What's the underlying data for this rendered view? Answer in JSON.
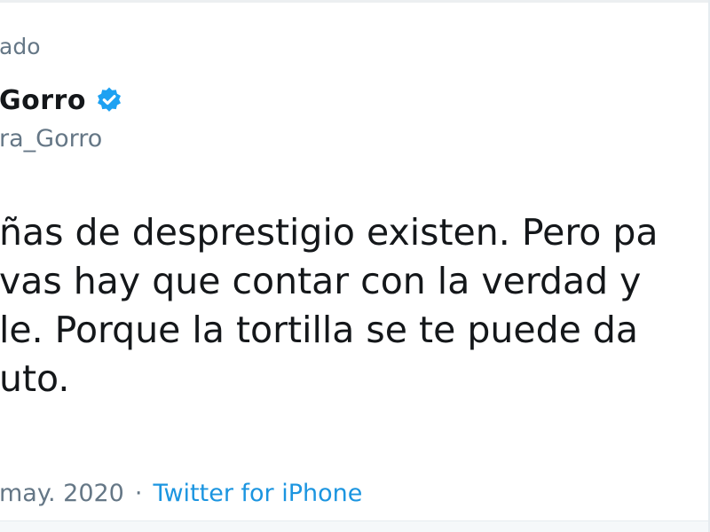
{
  "tweet": {
    "pinned_label": "ado",
    "display_name": "Gorro",
    "handle": "ra_Gorro",
    "lines": [
      "ñas de desprestigio existen. Pero pa",
      "vas hay que contar con la verdad y",
      "le. Porque la tortilla se te puede da",
      "uto."
    ],
    "date": "may. 2020",
    "separator": "·",
    "source": "Twitter for iPhone"
  },
  "icons": {
    "verified": "verified-badge-icon"
  },
  "colors": {
    "text": "#14171a",
    "muted": "#657786",
    "accent": "#1b95e0",
    "verified": "#1da1f2"
  }
}
